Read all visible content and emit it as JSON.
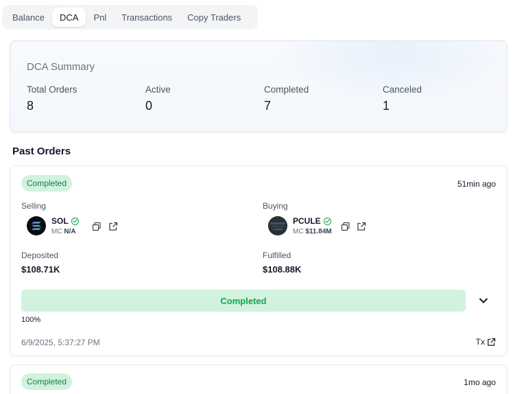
{
  "tabs": [
    {
      "label": "Balance",
      "active": false
    },
    {
      "label": "DCA",
      "active": true
    },
    {
      "label": "Pnl",
      "active": false
    },
    {
      "label": "Transactions",
      "active": false
    },
    {
      "label": "Copy Traders",
      "active": false
    }
  ],
  "summary": {
    "title": "DCA Summary",
    "stats": [
      {
        "label": "Total Orders",
        "value": "8"
      },
      {
        "label": "Active",
        "value": "0"
      },
      {
        "label": "Completed",
        "value": "7"
      },
      {
        "label": "Canceled",
        "value": "1"
      }
    ]
  },
  "past_orders": {
    "title": "Past Orders",
    "orders": [
      {
        "status": "Completed",
        "time_ago": "51min ago",
        "selling": {
          "label": "Selling",
          "token": "SOL",
          "mc_label": "MC",
          "mc_value": "N/A",
          "icon": "solana-logo-icon"
        },
        "buying": {
          "label": "Buying",
          "token": "PCULE",
          "mc_label": "MC",
          "mc_value": "$11.84M",
          "icon": "pcule-logo-icon"
        },
        "deposited_label": "Deposited",
        "deposited_value": "$108.71K",
        "fulfilled_label": "Fulfilled",
        "fulfilled_value": "$108.88K",
        "progress_label": "Completed",
        "progress_percent": "100%",
        "progress_fraction": 1.0,
        "date": "6/9/2025, 5:37:27 PM",
        "tx_label": "Tx"
      },
      {
        "status": "Completed",
        "time_ago": "1mo ago"
      }
    ]
  },
  "colors": {
    "accent_green": "#16a34a",
    "badge_bg": "#d1f2df",
    "progress_fill": "#d0f2de"
  }
}
